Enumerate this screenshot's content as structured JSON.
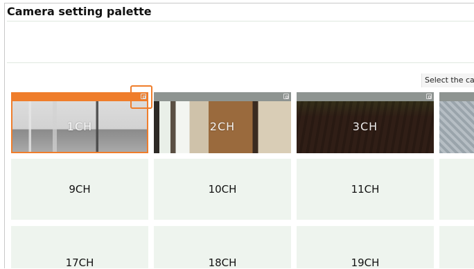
{
  "title": "Camera setting palette",
  "instruction": "Select the ca",
  "selected_channel": "1CH",
  "thumbnails": [
    {
      "label": "1CH",
      "selected": true
    },
    {
      "label": "2CH",
      "selected": false
    },
    {
      "label": "3CH",
      "selected": false
    }
  ],
  "rows": [
    [
      "9CH",
      "10CH",
      "11CH"
    ],
    [
      "17CH",
      "18CH",
      "19CH"
    ]
  ],
  "icons": {
    "expand": "expand-icon"
  },
  "colors": {
    "accent": "#ef7d2b",
    "cell_bg": "#eef4ee",
    "bar": "#8e9491"
  }
}
